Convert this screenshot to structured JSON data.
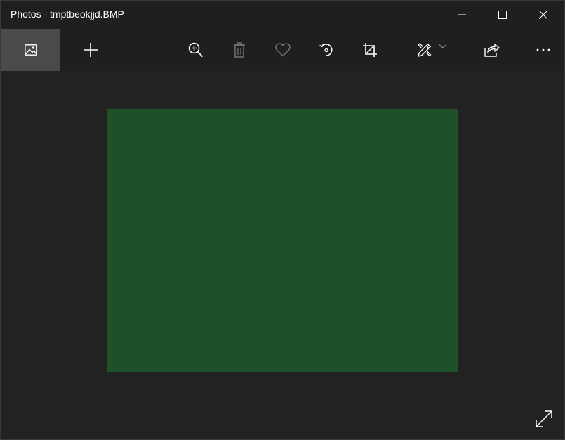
{
  "window": {
    "title": "Photos - tmptbeokjjd.BMP"
  },
  "toolbar": {
    "buttons": [
      {
        "id": "collection",
        "icon": "image-icon"
      },
      {
        "id": "add",
        "icon": "plus-icon"
      },
      {
        "id": "zoom",
        "icon": "zoom-in-icon"
      },
      {
        "id": "delete",
        "icon": "trash-icon",
        "enabled": false
      },
      {
        "id": "favorite",
        "icon": "heart-icon",
        "enabled": false
      },
      {
        "id": "rotate",
        "icon": "rotate-icon"
      },
      {
        "id": "crop",
        "icon": "crop-icon"
      },
      {
        "id": "edit",
        "icon": "edit-pen-icon"
      },
      {
        "id": "share",
        "icon": "share-icon"
      },
      {
        "id": "more",
        "icon": "more-icon"
      }
    ]
  },
  "viewer": {
    "image_color": "#1e5129",
    "fullscreen_icon": "expand-icon"
  },
  "colors": {
    "background": "#222222",
    "titlebar": "#1f1f1f",
    "active_button": "#4a4a4a",
    "icon": "#ffffff",
    "icon_disabled": "#7a7a7a"
  }
}
